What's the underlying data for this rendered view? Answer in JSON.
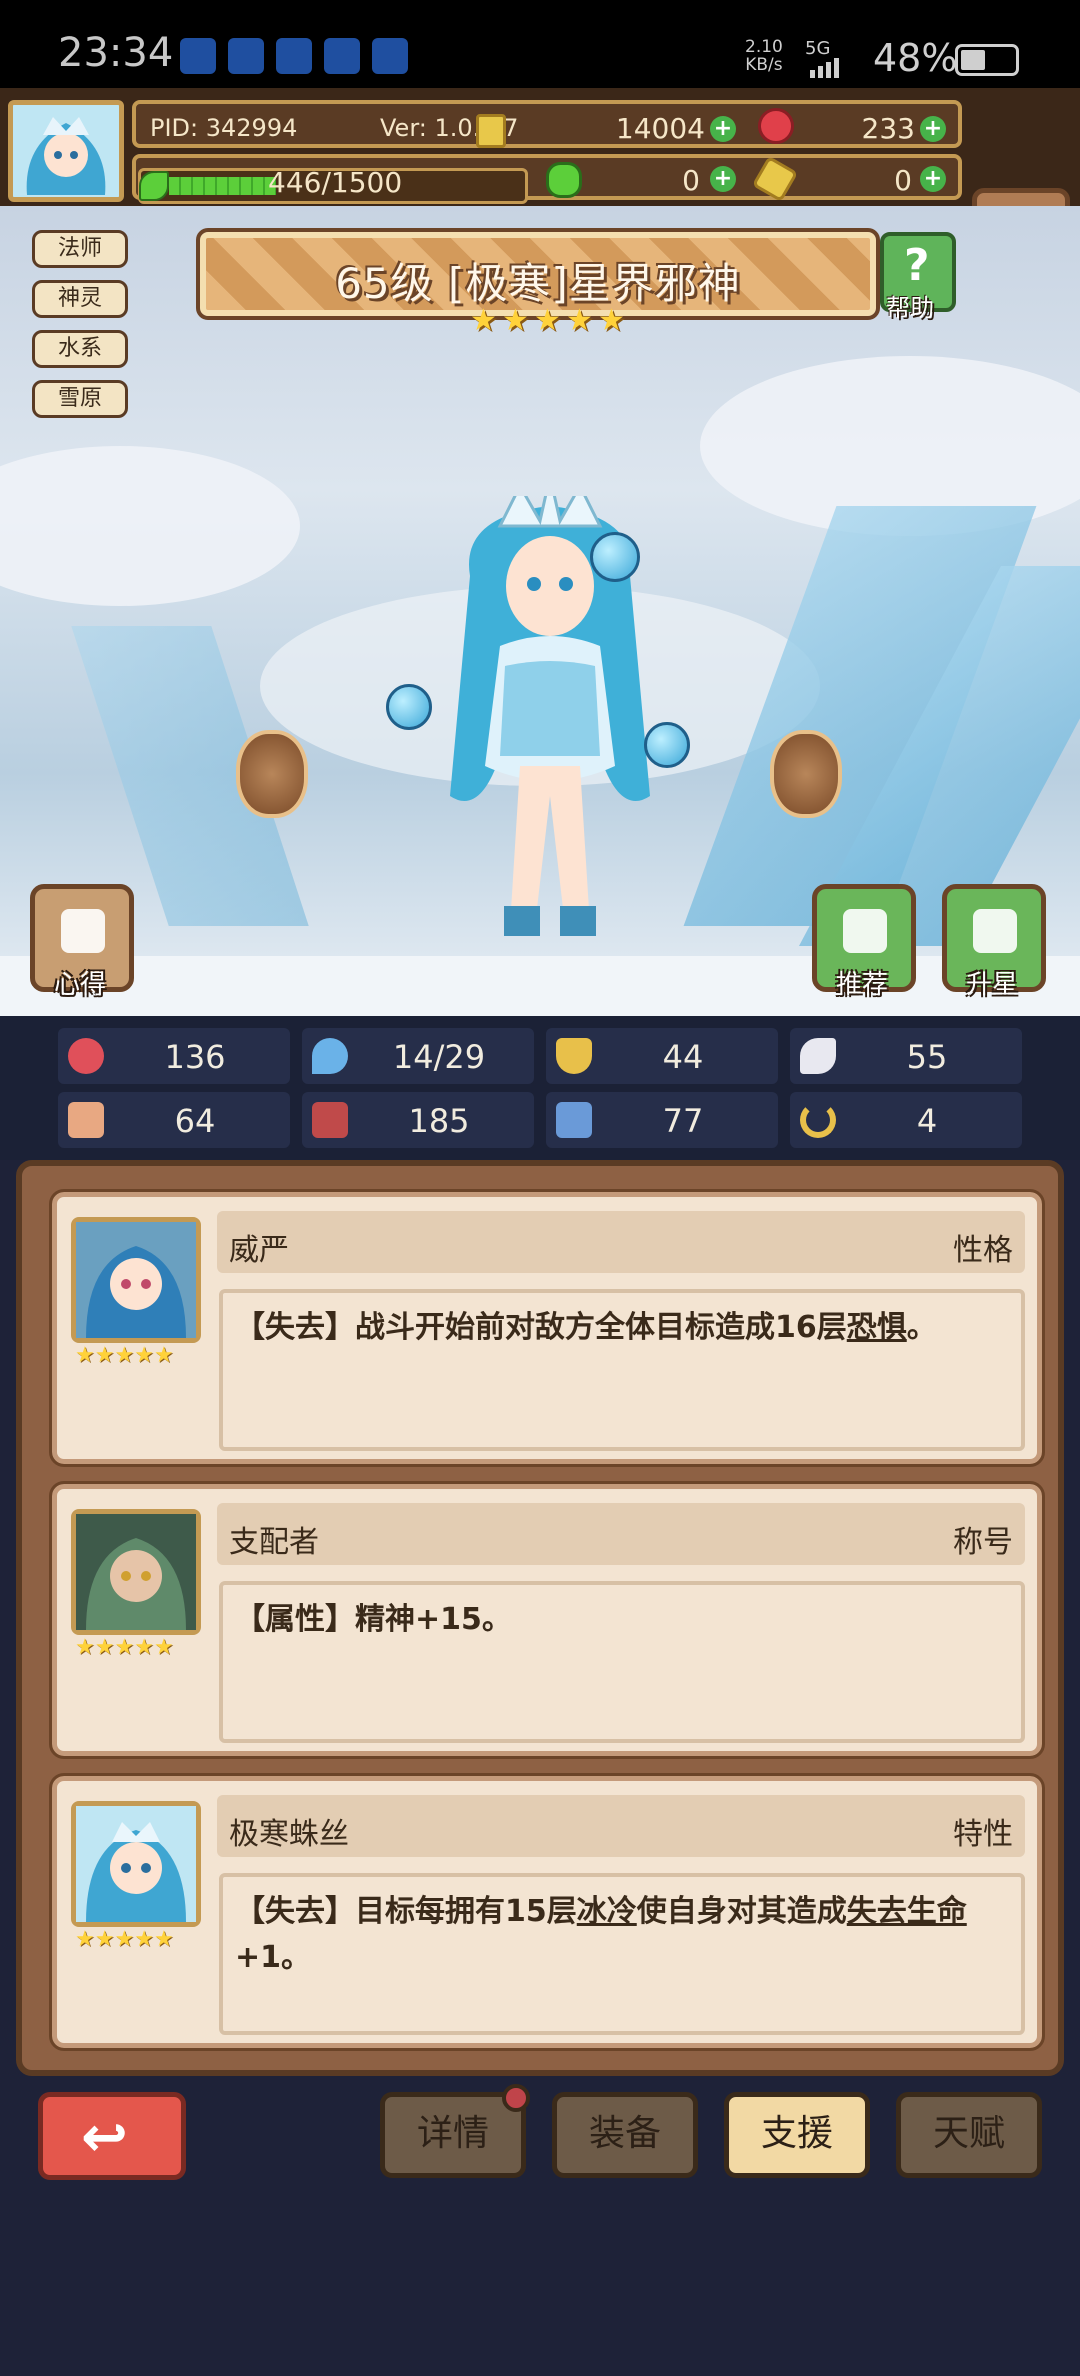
{
  "status_bar": {
    "time": "23:34",
    "net_speed": "2.10",
    "net_unit": "KB/s",
    "network": "5G",
    "battery": "48%"
  },
  "resources": {
    "pid": "PID: 342994",
    "version": "Ver: 1.0.0.7",
    "gold": "14004",
    "gems": "233",
    "energy": "446/1500",
    "energy_fraction": 0.297,
    "clover": "0",
    "keys": "0"
  },
  "hero": {
    "tags": [
      "法师",
      "神灵",
      "水系",
      "雪原"
    ],
    "title": "65级 [极寒]星界邪神",
    "stars": 5,
    "help_label": "帮助"
  },
  "actions": {
    "insight": "心得",
    "recommend": "推荐",
    "star_up": "升星"
  },
  "stats": [
    {
      "icon": "heart-icon",
      "value": "136",
      "color": "#e0505a"
    },
    {
      "icon": "water-drop-icon",
      "value": "14/29",
      "color": "#6ab2e8"
    },
    {
      "icon": "shield-icon",
      "value": "44",
      "color": "#e8c04a"
    },
    {
      "icon": "wing-icon",
      "value": "55",
      "color": "#e8e8f0"
    },
    {
      "icon": "fist-icon",
      "value": "64",
      "color": "#e8a882"
    },
    {
      "icon": "book-icon",
      "value": "185",
      "color": "#c04a4a"
    },
    {
      "icon": "boot-icon",
      "value": "77",
      "color": "#6a9ad8"
    },
    {
      "icon": "horseshoe-icon",
      "value": "4",
      "color": "#e8c04a"
    }
  ],
  "cards": [
    {
      "name": "威严",
      "kind": "性格",
      "desc_pre": "【失去】战斗开始前对敌方全体目标造成16层",
      "desc_u1": "恐惧",
      "desc_mid": "。",
      "desc_u2": "",
      "desc_post": ""
    },
    {
      "name": "支配者",
      "kind": "称号",
      "desc_pre": "【属性】精神+15。",
      "desc_u1": "",
      "desc_mid": "",
      "desc_u2": "",
      "desc_post": ""
    },
    {
      "name": "极寒蛛丝",
      "kind": "特性",
      "desc_pre": "【失去】目标每拥有15层",
      "desc_u1": "冰冷",
      "desc_mid": "使自身对其造成",
      "desc_u2": "失去生命",
      "desc_post": "+1。"
    }
  ],
  "nav": {
    "details": "详情",
    "equipment": "装备",
    "support": "支援",
    "talent": "天赋"
  },
  "colors": {
    "panel_brown": "#8e6144",
    "card_bg": "#f3e4d2",
    "accent_gold": "#c49a53",
    "back_red": "#e4574c"
  }
}
